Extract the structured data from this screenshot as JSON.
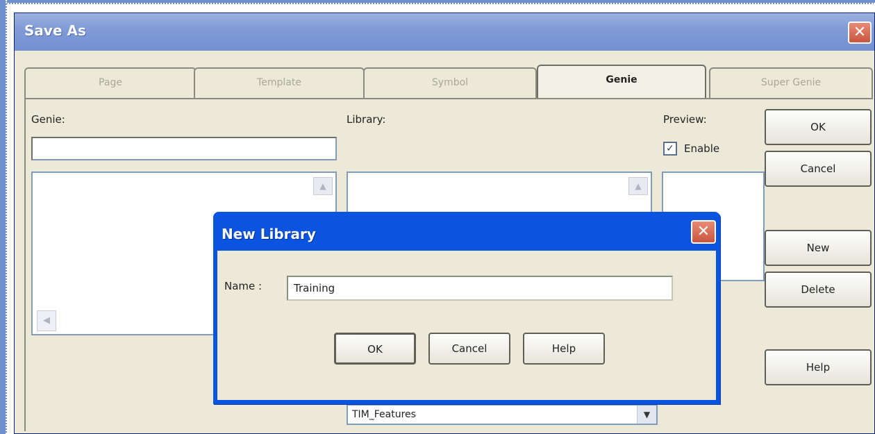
{
  "save_as": {
    "title": "Save As",
    "close_glyph": "✕",
    "tabs": [
      {
        "label": "Page",
        "active": false
      },
      {
        "label": "Template",
        "active": false
      },
      {
        "label": "Symbol",
        "active": false
      },
      {
        "label": "Genie",
        "active": true
      },
      {
        "label": "Super Genie",
        "active": false
      }
    ],
    "genie_label": "Genie:",
    "genie_value": "",
    "library_label": "Library:",
    "preview_label": "Preview:",
    "enable_label": "Enable",
    "enable_checked": true,
    "library_combo_value": "TIM_Features",
    "buttons": {
      "ok": "OK",
      "cancel": "Cancel",
      "new": "New",
      "delete": "Delete",
      "help": "Help"
    }
  },
  "new_library": {
    "title": "New Library",
    "close_glyph": "✕",
    "name_label": "Name :",
    "name_value": "Training",
    "buttons": {
      "ok": "OK",
      "cancel": "Cancel",
      "help": "Help"
    }
  },
  "icons": {
    "scroll_up": "▲",
    "scroll_left": "◀",
    "combo_down": "▼",
    "check": "✓"
  }
}
